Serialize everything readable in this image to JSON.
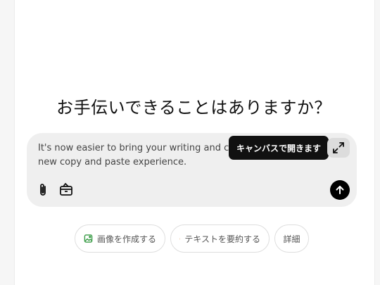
{
  "main": {
    "heading": "お手伝いできることはありますか？"
  },
  "composer": {
    "text_line1": "It's now easier to bring your writing and coc",
    "text_line2": "new copy and paste experience.",
    "tooltip": "キャンバスで開きます"
  },
  "suggestions": [
    {
      "label": "画像を作成する",
      "icon": "image-icon",
      "color": "#3a9c47"
    },
    {
      "label": "テキストを要約する",
      "icon": "document-icon",
      "color": "#e08a3c"
    },
    {
      "label": "詳細"
    }
  ]
}
